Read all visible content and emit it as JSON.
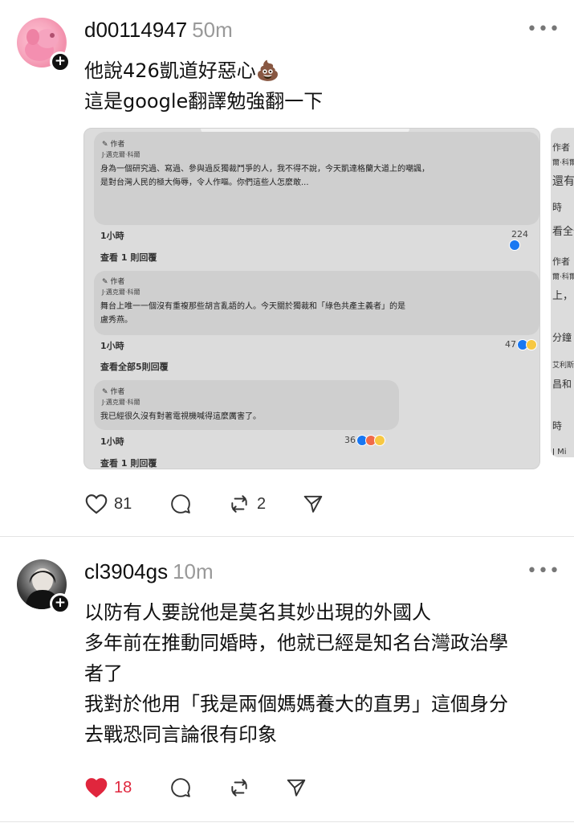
{
  "post1": {
    "username": "d00114947",
    "time": "50m",
    "more": "•••",
    "lines": [
      "他說426凱道好惡心💩",
      "這是google翻譯勉強翻一下"
    ],
    "screenshot": {
      "comments": [
        {
          "author_tag": "作者",
          "name": "J·邁克爾·科爾",
          "text": [
            "身為一個研究過、寫過、參與過反獨裁鬥爭的人，我不得不說，今天凱達格蘭大道上的嘲諷，",
            "是對台灣人民的極大侮辱，令人作嘔。你們這些人怎麼敢..."
          ],
          "time": "1小時",
          "count": "224",
          "replies": "查看 1 則回覆"
        },
        {
          "author_tag": "作者",
          "name": "J·邁克爾·科爾",
          "text": [
            "舞台上唯一一個沒有重複那些胡言亂語的人。今天關於獨裁和「綠色共產主義者」的是",
            "盧秀燕。"
          ],
          "time": "1小時",
          "count": "47",
          "replies": "查看全部5則回覆"
        },
        {
          "author_tag": "作者",
          "name": "J·邁克爾·科爾",
          "text": [
            "我已經很久沒有對著電視機喊得這麼厲害了。"
          ],
          "time": "1小時",
          "count": "36",
          "replies": "查看 1 則回覆"
        }
      ],
      "side_fragments": [
        "作者",
        "爾·科爾",
        "還有",
        "時",
        "看全部",
        "作者",
        "爾·科爾",
        "上，",
        "分鐘",
        "艾利斯",
        "昌和",
        "時",
        "J Mi"
      ]
    },
    "actions": {
      "likes": "81",
      "comments": "",
      "reposts": "2",
      "shares": ""
    }
  },
  "post2": {
    "username": "cl3904gs",
    "time": "10m",
    "more": "•••",
    "lines": [
      "以防有人要說他是莫名其妙出現的外國人",
      "多年前在推動同婚時，他就已經是知名台灣政治學",
      "者了",
      "我對於他用「我是兩個媽媽養大的直男」這個身分",
      "去戰恐同言論很有印象"
    ],
    "actions": {
      "likes": "18",
      "comments": "",
      "reposts": "",
      "shares": ""
    }
  },
  "colors": {
    "like_active": "#e0263d",
    "timestamp": "#999999",
    "text": "#111111"
  },
  "icons": {
    "like": "heart-icon",
    "comment": "comment-bubble-icon",
    "repost": "repost-icon",
    "share": "send-icon",
    "more": "more-dots-icon",
    "follow": "plus-icon"
  }
}
